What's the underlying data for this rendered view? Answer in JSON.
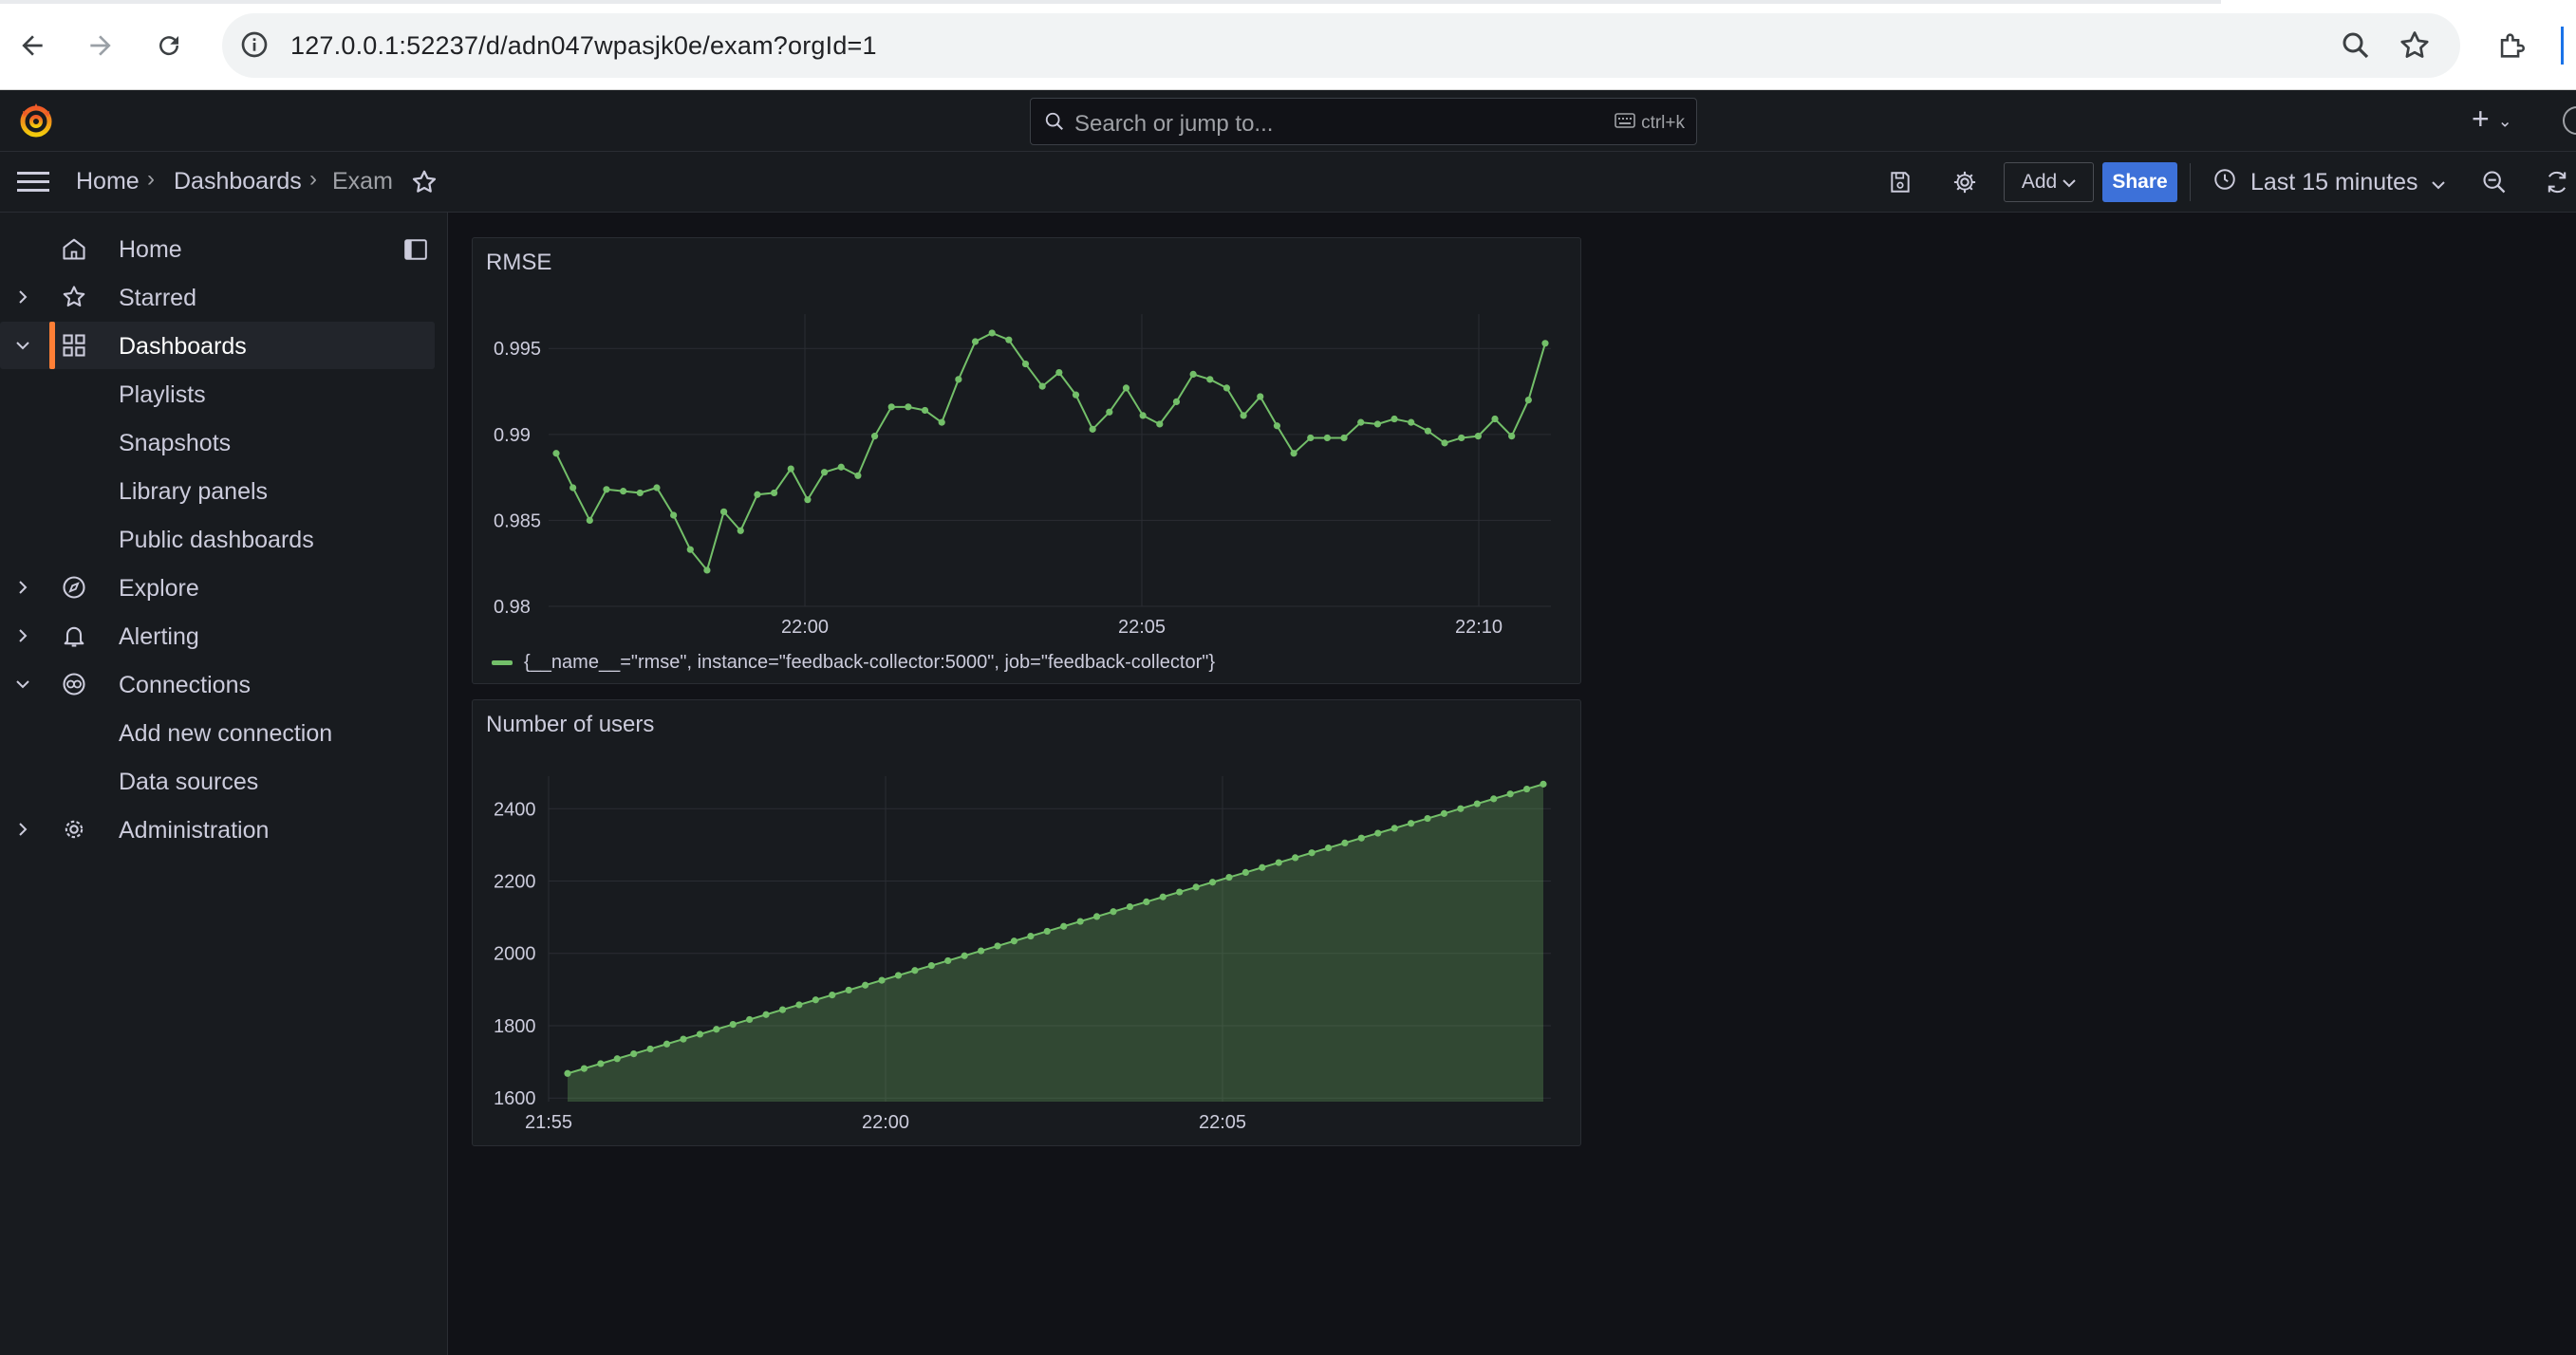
{
  "browser": {
    "url": "127.0.0.1:52237/d/adn047wpasjk0e/exam?orgId=1"
  },
  "topbar": {
    "search_placeholder": "Search or jump to...",
    "search_shortcut": "ctrl+k"
  },
  "breadcrumb": {
    "home": "Home",
    "dashboards": "Dashboards",
    "current": "Exam"
  },
  "toolbar": {
    "add_label": "Add",
    "share_label": "Share",
    "time_range": "Last 15 minutes"
  },
  "sidebar": {
    "items": [
      {
        "label": "Home",
        "icon": "home-icon"
      },
      {
        "label": "Starred",
        "icon": "star-icon"
      },
      {
        "label": "Dashboards",
        "icon": "apps-icon"
      },
      {
        "label": "Playlists"
      },
      {
        "label": "Snapshots"
      },
      {
        "label": "Library panels"
      },
      {
        "label": "Public dashboards"
      },
      {
        "label": "Explore",
        "icon": "compass-icon"
      },
      {
        "label": "Alerting",
        "icon": "bell-icon"
      },
      {
        "label": "Connections",
        "icon": "connections-icon"
      },
      {
        "label": "Add new connection"
      },
      {
        "label": "Data sources"
      },
      {
        "label": "Administration",
        "icon": "cog-icon"
      }
    ]
  },
  "colors": {
    "series": "#73bf69",
    "accent": "#ff7f36",
    "share": "#3d71d9",
    "background": "#111217",
    "panel": "#181b1f"
  },
  "chart_data": [
    {
      "type": "line",
      "title": "RMSE",
      "xlabel": "",
      "ylabel": "",
      "x_ticks": [
        "22:00",
        "22:05",
        "22:10"
      ],
      "y_ticks": [
        "0.98",
        "0.985",
        "0.99",
        "0.995"
      ],
      "ylim": [
        0.98,
        0.997
      ],
      "legend_position": "bottom-left",
      "grid": true,
      "series": [
        {
          "name": "{__name__=\"rmse\", instance=\"feedback-collector:5000\", job=\"feedback-collector\"}",
          "color": "#73bf69",
          "values": [
            0.9889,
            0.9869,
            0.985,
            0.9868,
            0.9867,
            0.9866,
            0.9869,
            0.9853,
            0.9833,
            0.9821,
            0.9855,
            0.9844,
            0.9865,
            0.9866,
            0.988,
            0.9862,
            0.9878,
            0.9881,
            0.9876,
            0.9899,
            0.9916,
            0.9916,
            0.9914,
            0.9907,
            0.9932,
            0.9954,
            0.9959,
            0.9955,
            0.9941,
            0.9928,
            0.9936,
            0.9923,
            0.9903,
            0.9913,
            0.9927,
            0.9911,
            0.9906,
            0.9919,
            0.9935,
            0.9932,
            0.9927,
            0.9911,
            0.9922,
            0.9905,
            0.9889,
            0.9898,
            0.9898,
            0.9898,
            0.9907,
            0.9906,
            0.9909,
            0.9907,
            0.9902,
            0.9895,
            0.9898,
            0.9899,
            0.9909,
            0.9899,
            0.992,
            0.9953
          ]
        }
      ]
    },
    {
      "type": "area",
      "title": "Number of users",
      "xlabel": "",
      "ylabel": "",
      "x_ticks": [
        "21:55",
        "22:00",
        "22:05"
      ],
      "y_ticks": [
        "1600",
        "1800",
        "2000",
        "2200",
        "2400"
      ],
      "ylim": [
        1590,
        2490
      ],
      "legend_position": "none",
      "grid": true,
      "series": [
        {
          "color": "#73bf69",
          "start": 1668,
          "end": 2468,
          "points": 60
        }
      ]
    }
  ]
}
